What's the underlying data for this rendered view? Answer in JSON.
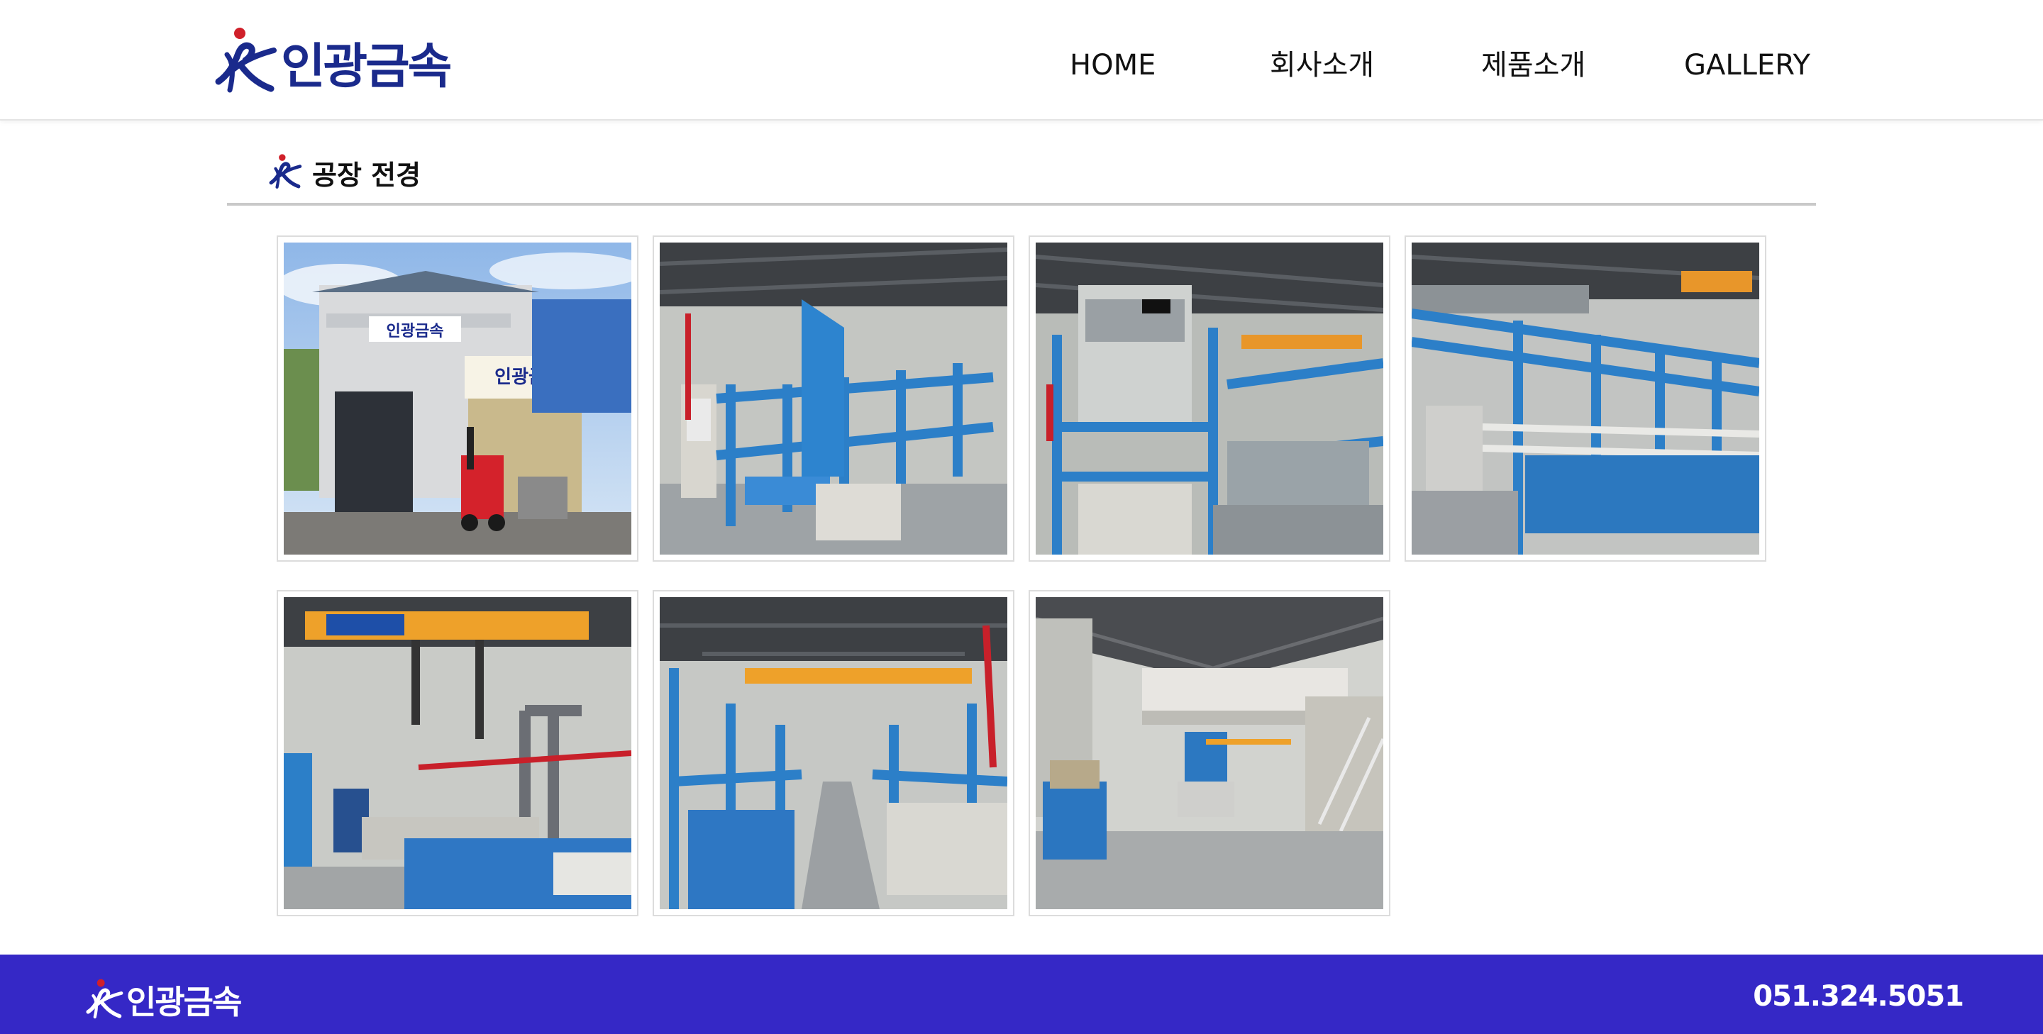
{
  "brand": {
    "name": "인광금속",
    "accent": "#1a2a8c",
    "dot_color": "#d0202a"
  },
  "nav": {
    "items": [
      {
        "label": "HOME"
      },
      {
        "label": "회사소개"
      },
      {
        "label": "제품소개"
      },
      {
        "label": "GALLERY"
      }
    ]
  },
  "section": {
    "title": "공장 전경"
  },
  "gallery": {
    "photos": [
      {
        "scene": "factory-exterior-with-signboard-and-forklift",
        "sign_text": "인광금속"
      },
      {
        "scene": "plating-line-blue-frames-control-panel"
      },
      {
        "scene": "plating-line-overhead-crane-and-tanks"
      },
      {
        "scene": "long-plating-line-blue-frame-pipes"
      },
      {
        "scene": "orange-overhead-crane-over-tanks"
      },
      {
        "scene": "aisle-between-plating-lines"
      },
      {
        "scene": "factory-interior-with-mezzanine-and-stairs"
      }
    ]
  },
  "footer": {
    "brand_name": "인광금속",
    "phone": "051.324.5051",
    "background": "#3528c6"
  }
}
